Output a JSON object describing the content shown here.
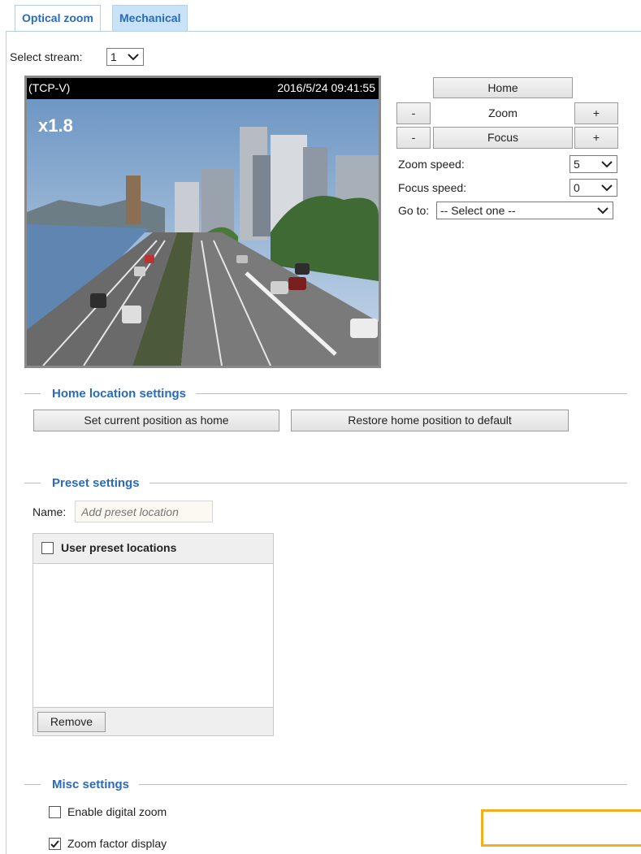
{
  "tabs": [
    {
      "label": "Optical zoom"
    },
    {
      "label": "Mechanical"
    }
  ],
  "stream": {
    "label": "Select stream:",
    "value": "1"
  },
  "video": {
    "protocol": "(TCP-V)",
    "timestamp": "2016/5/24 09:41:55",
    "zoom_factor": "x1.8"
  },
  "controls": {
    "home": "Home",
    "zoom": "Zoom",
    "focus": "Focus",
    "minus": "-",
    "plus": "+",
    "zoom_speed_label": "Zoom speed:",
    "zoom_speed_value": "5",
    "focus_speed_label": "Focus speed:",
    "focus_speed_value": "0",
    "goto_label": "Go to:",
    "goto_value": "-- Select one --"
  },
  "home_section": {
    "title": "Home location settings",
    "set_home": "Set current position as home",
    "restore_home": "Restore home position to default"
  },
  "preset_section": {
    "title": "Preset settings",
    "name_label": "Name:",
    "name_placeholder": "Add preset location",
    "list_header": "User preset locations",
    "remove": "Remove"
  },
  "misc_section": {
    "title": "Misc settings",
    "digital_zoom": {
      "label": "Enable digital zoom",
      "checked": false
    },
    "zoom_factor_display": {
      "label": "Zoom factor display",
      "checked": true
    }
  },
  "colors": {
    "accent": "#2a6bb8",
    "highlight": "#f2b01e"
  }
}
